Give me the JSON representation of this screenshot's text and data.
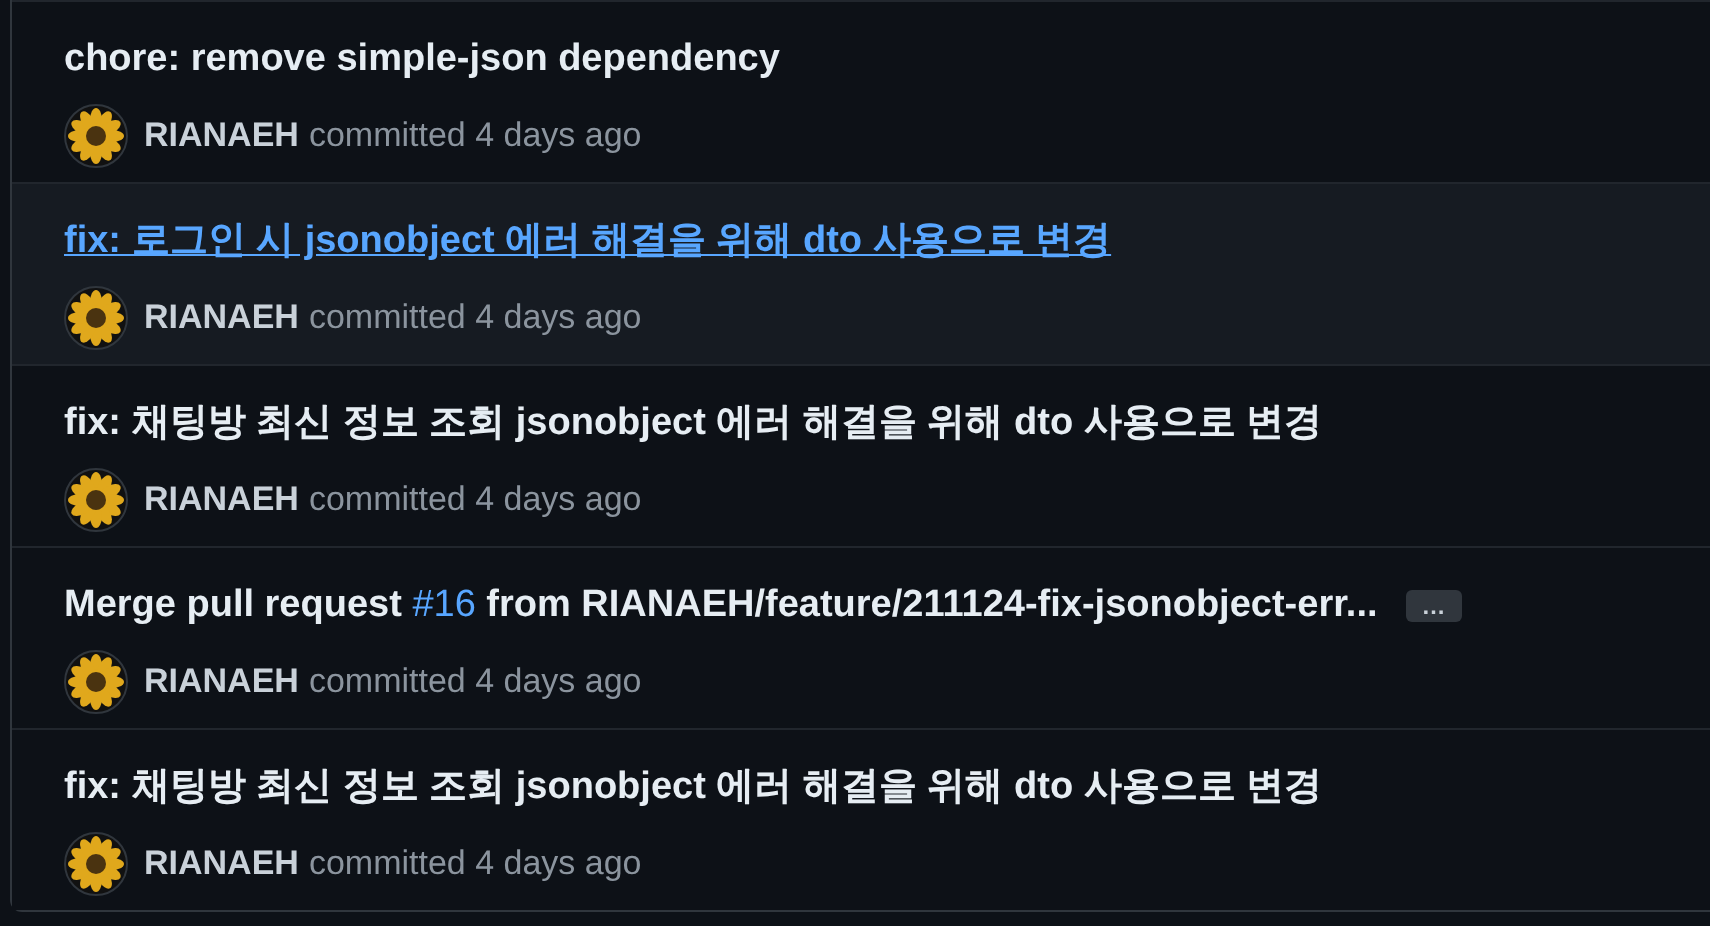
{
  "commits": [
    {
      "title": [
        {
          "text": "chore: remove simple-json dependency",
          "kind": "text"
        }
      ],
      "hovered": false,
      "author": "RIANAEH",
      "meta": "committed 4 days ago"
    },
    {
      "title": [
        {
          "text": "fix: 로그인 시 jsonobject 에러 해결을 위해 dto 사용으로 변경",
          "kind": "text"
        }
      ],
      "hovered": true,
      "author": "RIANAEH",
      "meta": "committed 4 days ago"
    },
    {
      "title": [
        {
          "text": "fix: 채팅방 최신 정보 조회 jsonobject 에러 해결을 위해 dto 사용으로 변경",
          "kind": "text"
        }
      ],
      "hovered": false,
      "author": "RIANAEH",
      "meta": "committed 4 days ago"
    },
    {
      "title": [
        {
          "text": "Merge pull request ",
          "kind": "text"
        },
        {
          "text": "#16",
          "kind": "issue_link"
        },
        {
          "text": " from RIANAEH/feature/211124-fix-jsonobject-err...",
          "kind": "text"
        }
      ],
      "hovered": false,
      "author": "RIANAEH",
      "meta": "committed 4 days ago",
      "more_button": "…"
    },
    {
      "title": [
        {
          "text": "fix: 채팅방 최신 정보 조회 jsonobject 에러 해결을 위해 dto 사용으로 변경",
          "kind": "text"
        }
      ],
      "hovered": false,
      "author": "RIANAEH",
      "meta": "committed 4 days ago"
    }
  ]
}
